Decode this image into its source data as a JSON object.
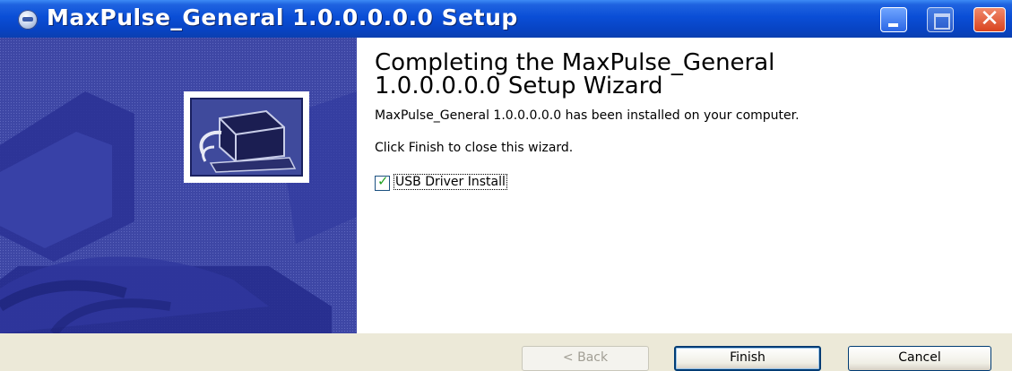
{
  "window": {
    "title": "MaxPulse_General 1.0.0.0.0.0 Setup",
    "icon": "setup-globe-icon",
    "controls": {
      "minimize": "minimize-icon",
      "maximize": "maximize-icon",
      "close": "✕"
    }
  },
  "content": {
    "heading_line1": "Completing the MaxPulse_General",
    "heading_line2": "1.0.0.0.0.0 Setup Wizard",
    "description": "MaxPulse_General 1.0.0.0.0.0 has been installed on your computer.",
    "finish_instruction": "Click Finish to close this wizard.",
    "checkbox": {
      "label": "USB Driver Install",
      "checked": true,
      "checkmark": "✓",
      "check_color": "#21a121"
    }
  },
  "buttons": {
    "back": "< Back",
    "finish": "Finish",
    "cancel": "Cancel"
  },
  "colors": {
    "titlebar": "#0a4ed6",
    "side_panel": "#3e47a5",
    "dialog_face": "#ece9d8"
  }
}
